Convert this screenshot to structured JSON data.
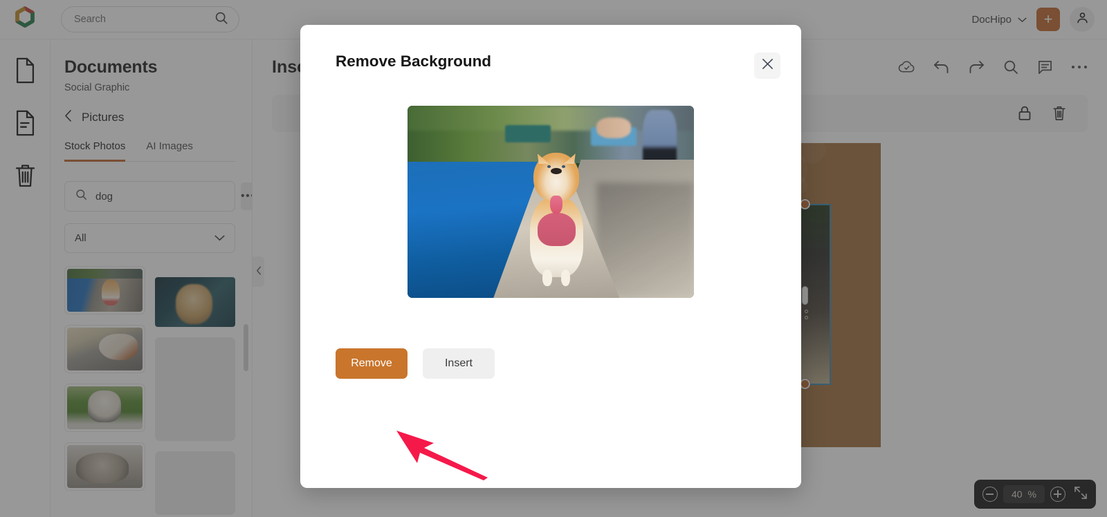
{
  "topbar": {
    "logo_icon": "dochipo-logo-icon",
    "search": {
      "placeholder": "Search",
      "value": "",
      "icon": "search-icon"
    },
    "workspace": {
      "name": "DocHipo",
      "chevron_icon": "chevron-down-icon"
    },
    "create_button": {
      "label": "+",
      "icon": "plus-icon",
      "color": "#c0652a"
    },
    "account": {
      "icon": "user-avatar-icon"
    }
  },
  "rail": {
    "items": [
      {
        "name": "blank-document",
        "icon": "document-icon",
        "active": false
      },
      {
        "name": "my-documents",
        "icon": "document-lines-icon",
        "active": true
      },
      {
        "name": "trash",
        "icon": "trash-icon",
        "active": false
      }
    ],
    "active_color": "#c0652a"
  },
  "panel": {
    "title": "Documents",
    "subtitle": "Social Graphic",
    "back": {
      "label": "Pictures",
      "icon": "chevron-left-icon"
    },
    "tabs": [
      {
        "label": "Stock Photos",
        "active": true
      },
      {
        "label": "AI Images",
        "active": false
      }
    ],
    "search": {
      "value": "dog",
      "placeholder": "Search",
      "icon": "search-icon"
    },
    "more_button": {
      "label": "•••",
      "icon": "ellipsis-icon"
    },
    "filter": {
      "value": "All",
      "chevron_icon": "chevron-down-icon"
    },
    "collapse_handle": {
      "icon": "chevron-left-icon"
    },
    "thumbnails": [
      {
        "id": "corgi-on-path",
        "column": "left",
        "kind": "photo",
        "style": "corgi-walk"
      },
      {
        "id": "dog-sleeping",
        "column": "left",
        "kind": "photo",
        "style": "dog-sleep"
      },
      {
        "id": "french-bulldog",
        "column": "left",
        "kind": "photo",
        "style": "frenchie"
      },
      {
        "id": "pug-portrait",
        "column": "left",
        "kind": "photo",
        "style": "pug"
      },
      {
        "id": "dog-dark-portrait",
        "column": "right",
        "kind": "photo",
        "style": "dark-dog"
      },
      {
        "id": "placeholder-1",
        "column": "right",
        "kind": "placeholder"
      },
      {
        "id": "placeholder-2",
        "column": "right",
        "kind": "placeholder"
      }
    ]
  },
  "editor": {
    "title": "Insert",
    "tools": [
      {
        "name": "cloud-saved",
        "icon": "cloud-check-icon"
      },
      {
        "name": "undo",
        "icon": "undo-arrow-icon"
      },
      {
        "name": "redo",
        "icon": "redo-arrow-icon"
      },
      {
        "name": "find",
        "icon": "search-icon"
      },
      {
        "name": "comments",
        "icon": "comment-icon"
      },
      {
        "name": "more-options",
        "icon": "ellipsis-icon"
      }
    ],
    "element_tools": [
      {
        "name": "lock-element",
        "icon": "lock-icon"
      },
      {
        "name": "delete-element",
        "icon": "trash-icon"
      }
    ],
    "canvas": {
      "background_color": "#a06c3a",
      "selection_color": "#2e87b8",
      "handle_color": "#c0652a"
    },
    "zoom": {
      "zoom_out_icon": "minus-circle-icon",
      "level": "40",
      "unit": "%",
      "zoom_in_icon": "plus-circle-icon",
      "fit_icon": "fullscreen-icon"
    }
  },
  "modal": {
    "title": "Remove Background",
    "close_icon": "close-icon",
    "preview": {
      "alt": "corgi-walking-on-stone-path-by-water"
    },
    "buttons": {
      "remove": {
        "label": "Remove",
        "color": "#c9752c"
      },
      "insert": {
        "label": "Insert",
        "color": "#efefef"
      }
    }
  },
  "annotation": {
    "type": "arrow",
    "color": "#f5194a",
    "points_at": "Remove"
  }
}
